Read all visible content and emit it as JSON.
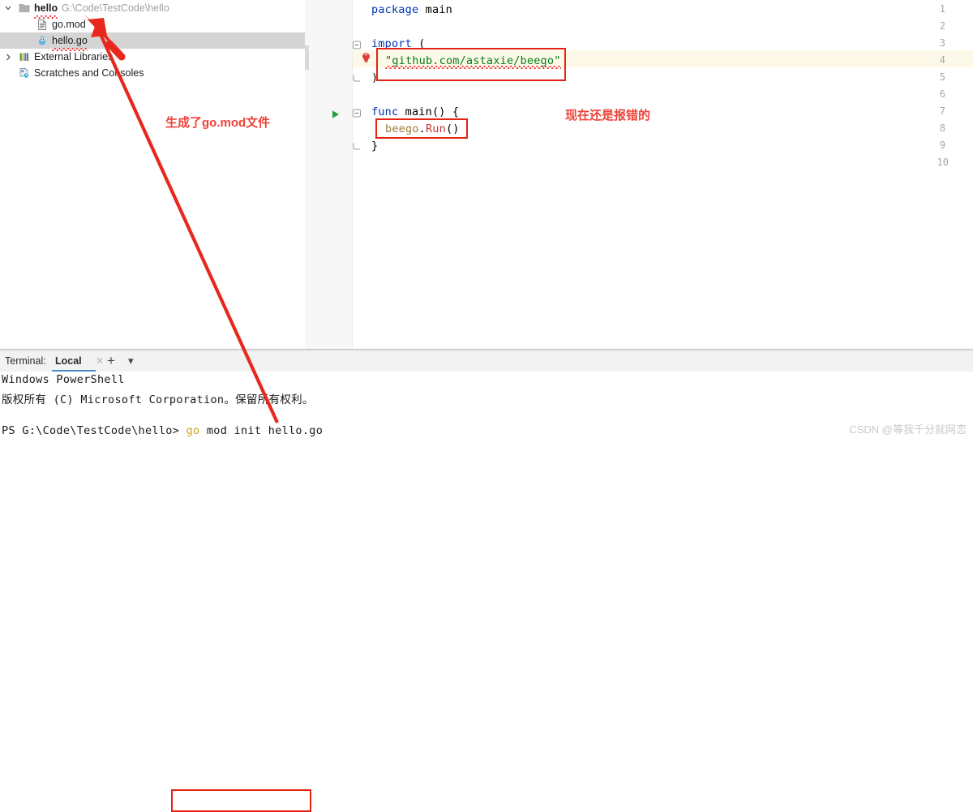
{
  "project_tree": {
    "rows": [
      {
        "label": "hello",
        "path": "G:\\Code\\TestCode\\hello",
        "icon": "folder-icon",
        "arrow": "chevron-down-icon"
      },
      {
        "label": "go.mod",
        "icon": "file-document-icon"
      },
      {
        "label": "hello.go",
        "icon": "go-gopher-icon"
      },
      {
        "label": "External Libraries",
        "icon": "libraries-icon",
        "arrow": "chevron-right-icon"
      },
      {
        "label": "Scratches and Consoles",
        "icon": "scratches-icon"
      }
    ]
  },
  "editor": {
    "line_numbers": [
      "1",
      "2",
      "3",
      "4",
      "5",
      "6",
      "7",
      "8",
      "9",
      "10"
    ],
    "lines": [
      {
        "n": 1,
        "text": "package main"
      },
      {
        "n": 2,
        "text": ""
      },
      {
        "n": 3,
        "text": "import ("
      },
      {
        "n": 4,
        "text": "    \"github.com/astaxie/beego\""
      },
      {
        "n": 5,
        "text": ")"
      },
      {
        "n": 6,
        "text": ""
      },
      {
        "n": 7,
        "text": "func main() {"
      },
      {
        "n": 8,
        "text": "    beego.Run()"
      },
      {
        "n": 9,
        "text": "}"
      },
      {
        "n": 10,
        "text": ""
      }
    ],
    "tokens": {
      "package_kw": "package",
      "package_name": " main",
      "import_kw": "import",
      "import_paren": " (",
      "import_string": "\"github.com/astaxie/beego\"",
      "close_paren": ")",
      "func_kw": "func",
      "func_sig": " main() {",
      "beego_ref": "beego",
      "dot": ".",
      "run_call": "Run",
      "run_parens": "()",
      "close_brace": "}"
    },
    "gutter_icons": {
      "error_bulb": "error-bulb-icon",
      "run_arrow": "run-gutter-icon",
      "fold_marker": "fold-minus-icon"
    },
    "highlighted_line": 4
  },
  "annotations": {
    "left_note": "生成了go.mod文件",
    "right_note": "现在还是报错的",
    "color": "#ef4136"
  },
  "terminal": {
    "label": "Terminal:",
    "tab": "Local",
    "close_icon": "close-icon",
    "add_icon": "plus-icon",
    "dropdown_icon": "chevron-down-icon",
    "lines": [
      {
        "text": "Windows PowerShell"
      },
      {
        "text": "版权所有 (C) Microsoft Corporation。保留所有权利。"
      },
      {
        "text": ""
      },
      {
        "prompt": "PS G:\\Code\\TestCode\\hello>",
        "cmd_head": "go",
        "cmd_tail": " mod init hello.go"
      }
    ]
  },
  "watermark": "CSDN @等我千分就网恋"
}
